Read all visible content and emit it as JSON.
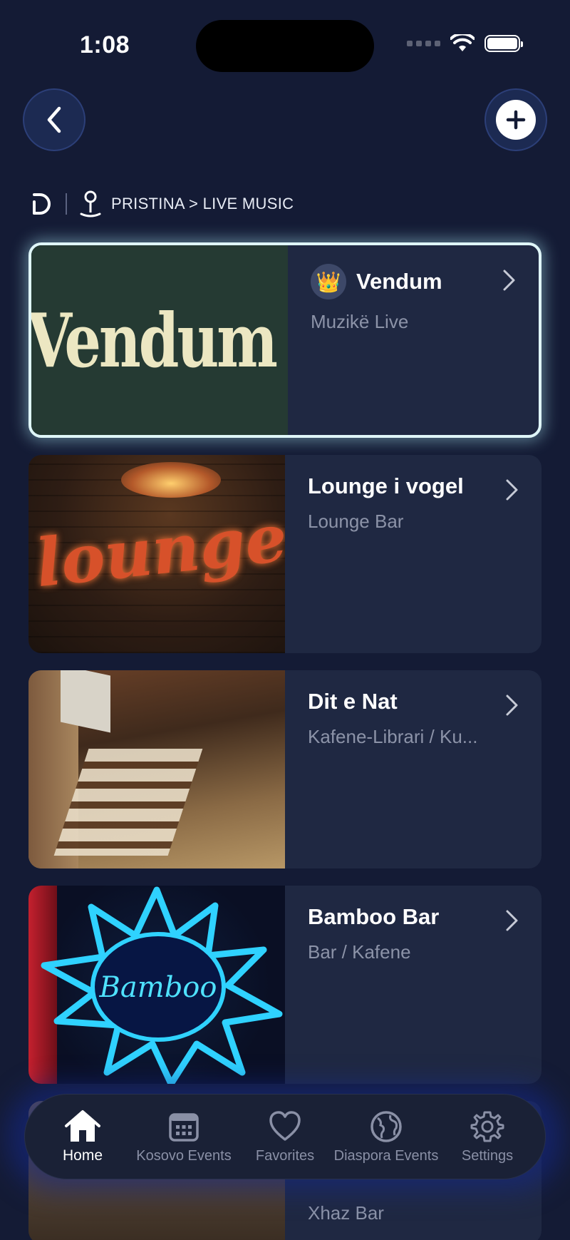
{
  "status_bar": {
    "time": "1:08"
  },
  "breadcrumb": {
    "path": "PRISTINA > LIVE MUSIC"
  },
  "venues": [
    {
      "title": "Vendum",
      "subtitle": "Muzikë Live",
      "image_text": "Vendum",
      "featured": true,
      "badge": "crown-icon"
    },
    {
      "title": "Lounge i vogel",
      "subtitle": "Lounge Bar",
      "image_text": "lounge"
    },
    {
      "title": "Dit e Nat",
      "subtitle": "Kafene-Librari / Ku..."
    },
    {
      "title": "Bamboo Bar",
      "subtitle": "Bar / Kafene",
      "image_text": "Bamboo"
    },
    {
      "title": "",
      "subtitle": "Xhaz Bar"
    }
  ],
  "tabbar": {
    "tabs": [
      {
        "label": "Home",
        "icon": "home-icon",
        "active": true
      },
      {
        "label": "Kosovo Events",
        "icon": "calendar-icon"
      },
      {
        "label": "Favorites",
        "icon": "heart-icon"
      },
      {
        "label": "Diaspora Events",
        "icon": "globe-icon"
      },
      {
        "label": "Settings",
        "icon": "gear-icon"
      }
    ]
  },
  "colors": {
    "background": "#141b35",
    "card": "#1f2842",
    "featured_border": "#dff6f8",
    "muted_text": "#8c93a8"
  }
}
